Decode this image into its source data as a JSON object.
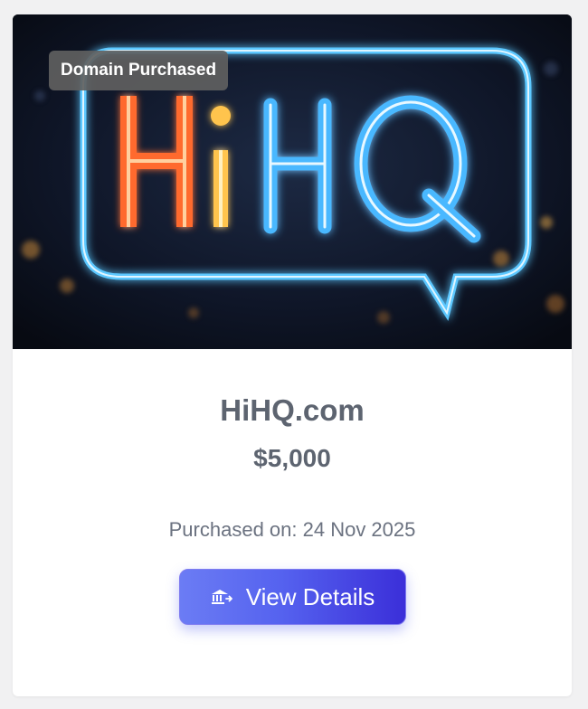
{
  "card": {
    "badge": "Domain Purchased",
    "title": "HiHQ.com",
    "price": "$5,000",
    "purchased_text": "Purchased on: 24 Nov 2025",
    "button_label": "View Details",
    "button_icon": "bank-transfer-icon"
  },
  "hero_image": {
    "sign_text_left": "Hi",
    "sign_text_right": "HQ",
    "colors": {
      "orange": "#ff7a3d",
      "yellow": "#ffd37a",
      "blue": "#5cc8ff",
      "background": "#0b0f1a"
    }
  }
}
